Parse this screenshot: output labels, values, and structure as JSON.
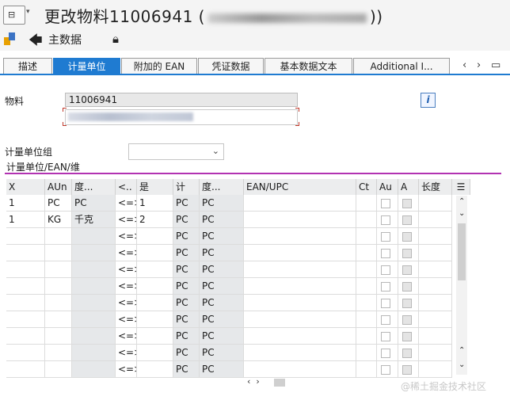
{
  "window": {
    "title": "更改物料11006941 (",
    "title_end": "))"
  },
  "toolbar": {
    "main_data_label": "主数据"
  },
  "tabs": [
    {
      "label": "描述",
      "active": false
    },
    {
      "label": "计量单位",
      "active": true
    },
    {
      "label": "附加的 EAN",
      "active": false
    },
    {
      "label": "凭证数据",
      "active": false
    },
    {
      "label": "基本数据文本",
      "active": false
    },
    {
      "label": "Additional I...",
      "active": false
    }
  ],
  "fields": {
    "material_label": "物料",
    "material_value": "11006941",
    "uom_group_label": "计量单位组",
    "uom_group_value": ""
  },
  "group": {
    "title": "计量单位/EAN/维"
  },
  "table": {
    "headers": [
      "X",
      "AUn",
      "度...",
      "<..",
      "是",
      "计",
      "度...",
      "EAN/UPC",
      "Ct",
      "Au",
      "A",
      "长度"
    ],
    "rows": [
      {
        "x": "1",
        "aun": "PC",
        "du": "PC",
        "op": "<=>",
        "shi": "1",
        "ji": "PC",
        "du2": "PC"
      },
      {
        "x": "1",
        "aun": "KG",
        "du": "千克",
        "op": "<=>",
        "shi": "2",
        "ji": "PC",
        "du2": "PC"
      },
      {
        "x": "",
        "aun": "",
        "du": "",
        "op": "<=>",
        "shi": "",
        "ji": "PC",
        "du2": "PC"
      },
      {
        "x": "",
        "aun": "",
        "du": "",
        "op": "<=>",
        "shi": "",
        "ji": "PC",
        "du2": "PC"
      },
      {
        "x": "",
        "aun": "",
        "du": "",
        "op": "<=>",
        "shi": "",
        "ji": "PC",
        "du2": "PC"
      },
      {
        "x": "",
        "aun": "",
        "du": "",
        "op": "<=>",
        "shi": "",
        "ji": "PC",
        "du2": "PC"
      },
      {
        "x": "",
        "aun": "",
        "du": "",
        "op": "<=>",
        "shi": "",
        "ji": "PC",
        "du2": "PC"
      },
      {
        "x": "",
        "aun": "",
        "du": "",
        "op": "<=>",
        "shi": "",
        "ji": "PC",
        "du2": "PC"
      },
      {
        "x": "",
        "aun": "",
        "du": "",
        "op": "<=>",
        "shi": "",
        "ji": "PC",
        "du2": "PC"
      },
      {
        "x": "",
        "aun": "",
        "du": "",
        "op": "<=>",
        "shi": "",
        "ji": "PC",
        "du2": "PC"
      },
      {
        "x": "",
        "aun": "",
        "du": "",
        "op": "<=>",
        "shi": "",
        "ji": "PC",
        "du2": "PC"
      }
    ]
  },
  "watermark": "@稀土掘金技术社区",
  "icons": {
    "window_icon": "window-menu-icon",
    "back": "back-arrow-icon",
    "lock": "lock-icon",
    "info": "info-icon",
    "dropdown": "chevron-down-icon",
    "column_settings": "column-settings-icon"
  }
}
